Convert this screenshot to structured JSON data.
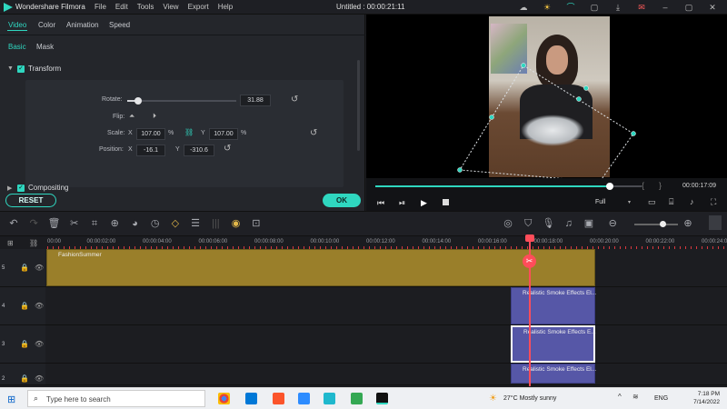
{
  "titlebar": {
    "app_name": "Wondershare Filmora",
    "menu": [
      "File",
      "Edit",
      "Tools",
      "View",
      "Export",
      "Help"
    ],
    "project_title": "Untitled : 00:00:21:11"
  },
  "editor": {
    "tabs": [
      "Video",
      "Color",
      "Animation",
      "Speed"
    ],
    "subtabs": [
      "Basic",
      "Mask"
    ],
    "transform_label": "Transform",
    "rotate": {
      "label": "Rotate:",
      "value": "31.88"
    },
    "flip": {
      "label": "Flip:"
    },
    "scale": {
      "label": "Scale:",
      "x_label": "X",
      "x_value": "107.00",
      "x_unit": "%",
      "y_label": "Y",
      "y_value": "107.00",
      "y_unit": "%"
    },
    "position": {
      "label": "Position:",
      "x_label": "X",
      "x_value": "-16.1",
      "y_label": "Y",
      "y_value": "-310.6"
    },
    "compositing_label": "Compositing",
    "reset_label": "RESET",
    "ok_label": "OK"
  },
  "preview": {
    "timecode": "00:00:17:09",
    "quality": "Full",
    "bracket_left": "{",
    "bracket_right": "}",
    "progress": 0.88
  },
  "timeline": {
    "ruler": [
      "00:00",
      "00:00:02:00",
      "00:00:04:00",
      "00:00:06:00",
      "00:00:08:00",
      "00:00:10:00",
      "00:00:12:00",
      "00:00:14:00",
      "00:00:16:00",
      "00:00:18:00",
      "00:00:20:00",
      "00:00:22:00",
      "00:00:24:0"
    ],
    "tracks": [
      {
        "num": "5",
        "clip": "FashionSummer"
      },
      {
        "num": "4",
        "clip": "Realistic Smoke Effects El..."
      },
      {
        "num": "3",
        "clip": "Realistic Smoke Effects E..."
      },
      {
        "num": "2",
        "clip": "Realistic Smoke Effects El..."
      }
    ]
  },
  "taskbar": {
    "search_placeholder": "Type here to search",
    "weather": "27°C  Mostly sunny",
    "lang": "ENG",
    "time": "7:18 PM",
    "date": "7/14/2022"
  }
}
